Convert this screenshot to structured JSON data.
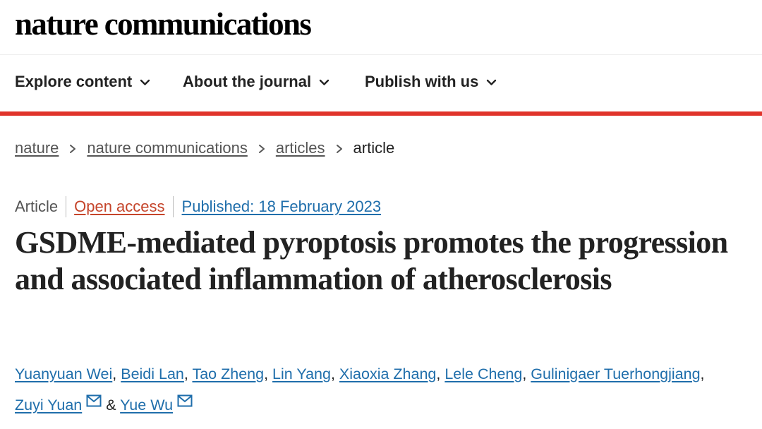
{
  "site": {
    "logo": "nature communications"
  },
  "nav": {
    "items": [
      {
        "label": "Explore content",
        "icon": "chevron-down-icon"
      },
      {
        "label": "About the journal",
        "icon": "chevron-down-icon"
      },
      {
        "label": "Publish with us",
        "icon": "chevron-down-icon"
      }
    ]
  },
  "colors": {
    "accent_bar": "#e0332a",
    "link": "#1f6eab",
    "open_access": "#c5442a"
  },
  "breadcrumb": {
    "items": [
      "nature",
      "nature communications",
      "articles"
    ],
    "current": "article",
    "separator_icon": "chevron-right-icon"
  },
  "article": {
    "type": "Article",
    "access": "Open access",
    "published": "Published: 18 February 2023",
    "title": "GSDME-mediated pyroptosis promotes the progression and associated inflammation of atherosclerosis",
    "authors": [
      "Yuanyuan Wei",
      "Beidi Lan",
      "Tao Zheng",
      "Lin Yang",
      "Xiaoxia Zhang",
      "Lele Cheng",
      "Gulinigaer Tuerhongjiang",
      "Zuyi Yuan",
      "Yue Wu"
    ],
    "author_separator": ",",
    "final_conjunction": "&",
    "corresponding_icon": "mail-icon"
  }
}
